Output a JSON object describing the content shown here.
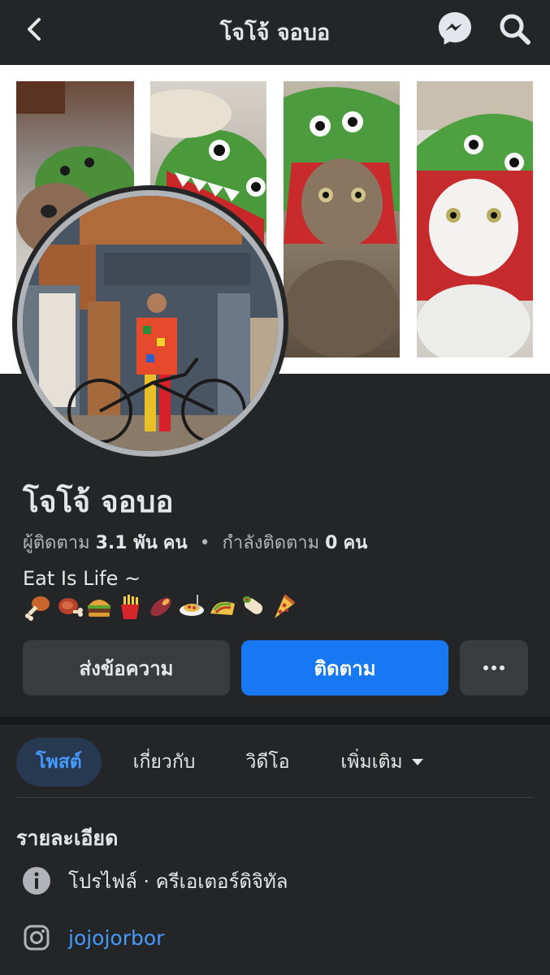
{
  "header": {
    "title": "โจโจ้ จอบอ"
  },
  "profile": {
    "name": "โจโจ้ จอบอ",
    "followers_label": "ผู้ติดตาม",
    "followers_count": "3.1 พัน",
    "followers_unit": "คน",
    "dot": "•",
    "following_label": "กำลังติดตาม",
    "following_count": "0",
    "following_unit": "คน",
    "bio": "Eat Is Life ~",
    "bio_emojis": [
      "poultry-leg",
      "meat-on-bone",
      "hamburger",
      "french-fries",
      "roasted-sweet-potato",
      "spaghetti",
      "taco",
      "burrito",
      "pizza"
    ]
  },
  "actions": {
    "message_label": "ส่งข้อความ",
    "follow_label": "ติดตาม",
    "more_label": "•••"
  },
  "tabs": [
    {
      "label": "โพสต์"
    },
    {
      "label": "เกี่ยวกับ"
    },
    {
      "label": "วิดีโอ"
    },
    {
      "label": "เพิ่มเติม"
    }
  ],
  "details": {
    "heading": "รายละเอียด",
    "profile_type": "โปรไฟล์ · ครีเอเตอร์ดิจิทัล",
    "instagram": "jojojorbor"
  },
  "colors": {
    "background": "#242526",
    "primary_button": "#1877f2",
    "secondary_button": "#3a3b3c",
    "active_tab_bg": "#263951",
    "link": "#4599ff"
  }
}
